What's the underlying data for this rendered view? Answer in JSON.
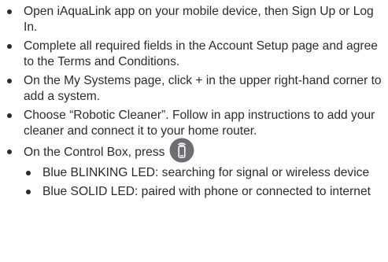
{
  "steps": [
    "Open iAquaLink app on your mobile device, then Sign Up or Log In.",
    "Complete all required fields in the Account Setup page and agree to the Terms and Conditions.",
    "On the My Systems page, click + in the upper right-hand corner to add a system.",
    "Choose “Robotic Cleaner”. Follow in app instructions to add your cleaner and connect it to your home router."
  ],
  "press_step": {
    "text": "On the Control Box, press",
    "icon": "wireless-phone-icon"
  },
  "led_states": [
    "Blue BLINKING LED: searching for signal or wireless device",
    "Blue SOLID LED: paired with phone or connected to internet"
  ],
  "colors": {
    "text": "#2b2b2b",
    "icon_fill": "#6d6e71"
  }
}
